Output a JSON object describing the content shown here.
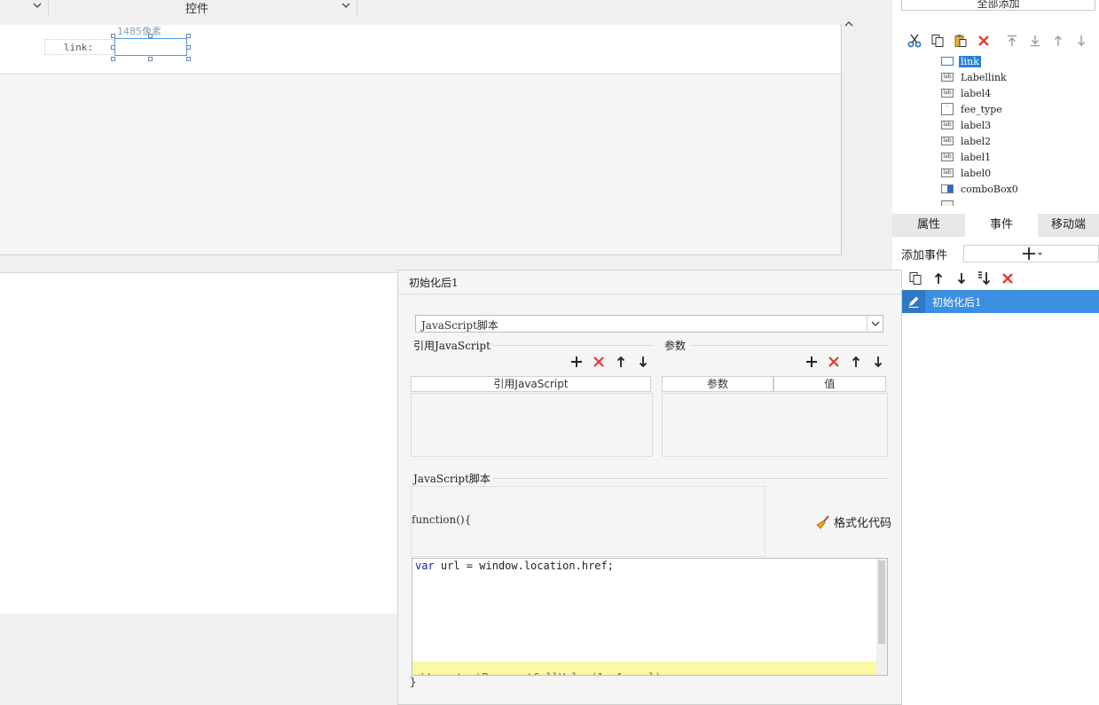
{
  "top_bar": {
    "control_label": "控件"
  },
  "canvas": {
    "pixel_hint": "1485像素",
    "link_label": "link:"
  },
  "right_panel": {
    "add_all_label": "全部添加",
    "tree_items": [
      {
        "label": "link",
        "selected": true,
        "icon": "textfield-icon"
      },
      {
        "label": "Labellink",
        "icon": "label-icon"
      },
      {
        "label": "label4",
        "icon": "label-icon"
      },
      {
        "label": "fee_type",
        "icon": "radiogroup-icon"
      },
      {
        "label": "label3",
        "icon": "label-icon"
      },
      {
        "label": "label2",
        "icon": "label-icon"
      },
      {
        "label": "label1",
        "icon": "label-icon"
      },
      {
        "label": "label0",
        "icon": "label-icon"
      },
      {
        "label": "comboBox0",
        "icon": "combobox-icon"
      }
    ],
    "tabs": [
      "属性",
      "事件",
      "移动端"
    ],
    "active_tab": "事件",
    "add_event_label": "添加事件",
    "event_item": "初始化后1"
  },
  "dialog": {
    "title": "初始化后1",
    "type_select": "JavaScript脚本",
    "ref_js_group": "引用JavaScript",
    "ref_js_column": "引用JavaScript",
    "params_group": "参数",
    "params_columns": [
      "参数",
      "值"
    ],
    "js_script_group": "JavaScript脚本",
    "func_open": "function(){",
    "format_button": "格式化代码",
    "code_line1_kw": "var",
    "code_line1_rest": " url = window.location.href;",
    "func_close": "}"
  },
  "colors": {
    "selection": "#2a7fd6",
    "event_item_bg": "#3c8fe0",
    "delete_red": "#e53935",
    "highlight_line": "#fbf8a6"
  }
}
